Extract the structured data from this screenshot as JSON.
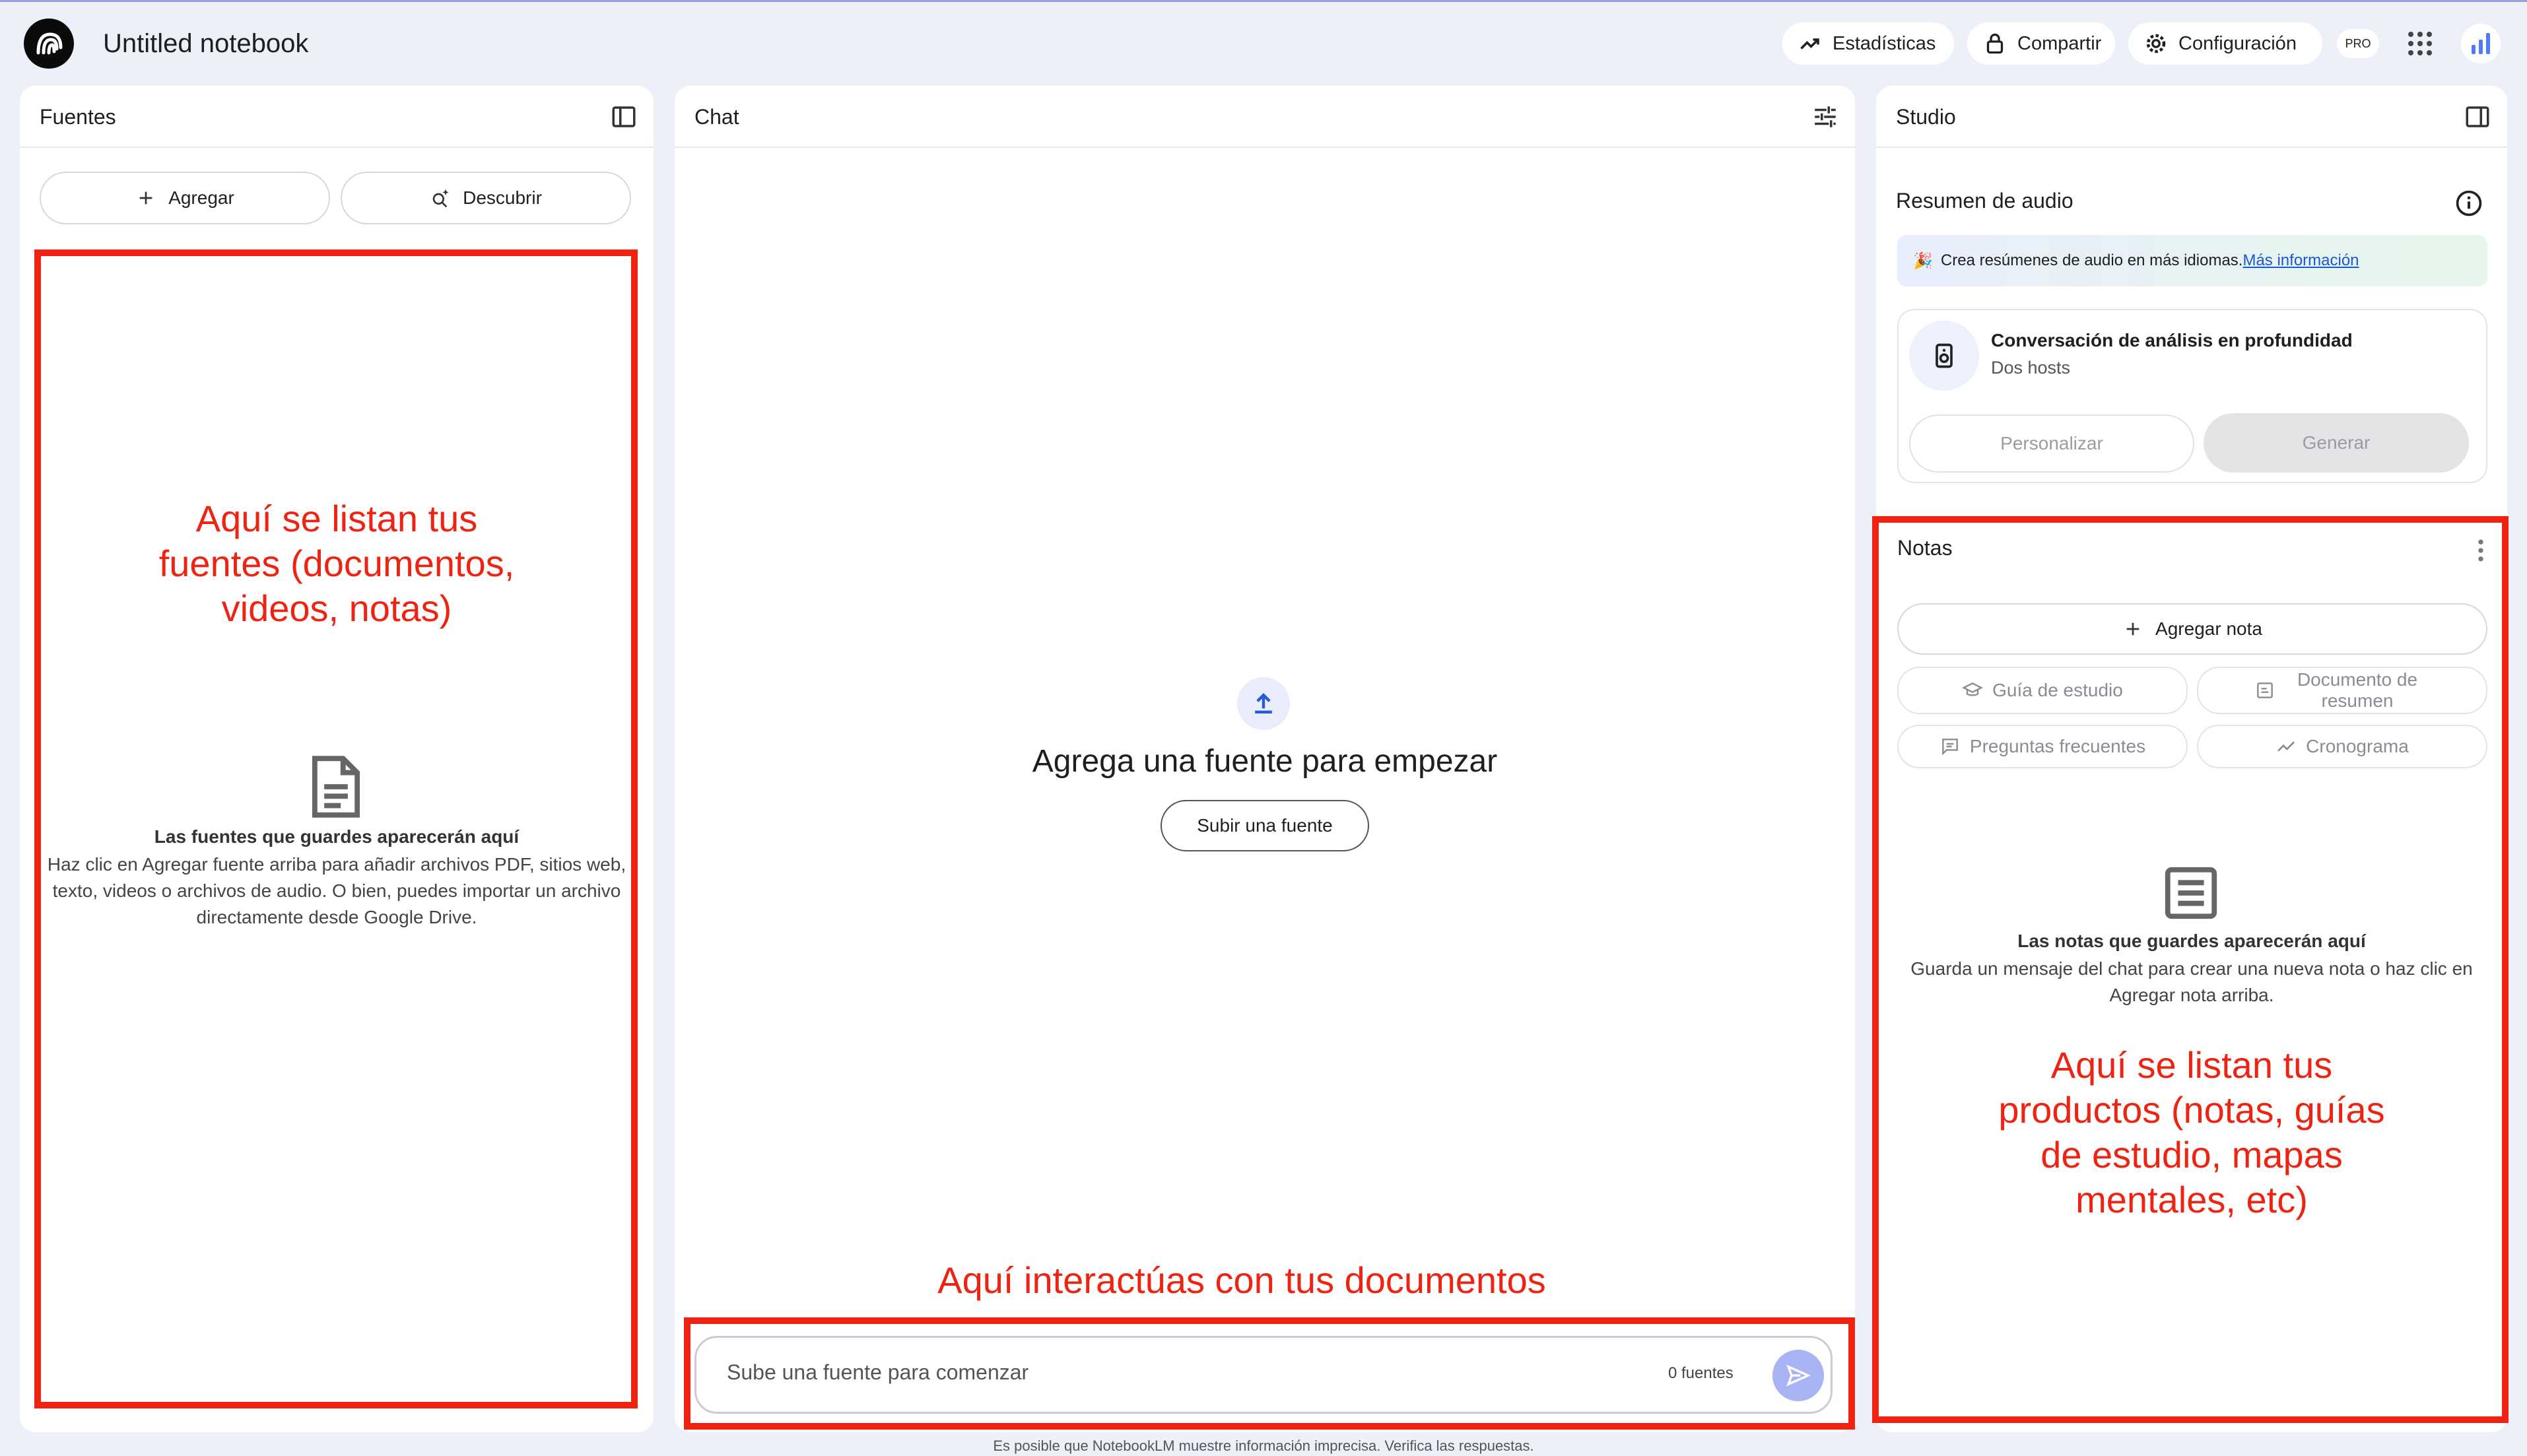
{
  "header": {
    "notebook_title": "Untitled notebook",
    "analytics_label": "Estadísticas",
    "share_label": "Compartir",
    "settings_label": "Configuración",
    "pro_badge": "PRO"
  },
  "sources": {
    "title": "Fuentes",
    "add_label": "Agregar",
    "discover_label": "Descubrir",
    "annotation": "Aquí se listan tus fuentes (documentos, videos, notas)",
    "empty_title": "Las fuentes que guardes aparecerán aquí",
    "empty_desc": "Haz clic en Agregar fuente arriba para añadir archivos PDF, sitios web, texto, videos o archivos de audio. O bien, puedes importar un archivo directamente desde Google Drive."
  },
  "chat": {
    "title": "Chat",
    "empty_heading": "Agrega una fuente para empezar",
    "upload_label": "Subir una fuente",
    "annotation": "Aquí interactúas con tus documentos",
    "input_placeholder": "Sube una fuente para comenzar",
    "source_count": "0 fuentes"
  },
  "studio": {
    "title": "Studio",
    "audio_title": "Resumen de audio",
    "banner_emoji": "🎉",
    "banner_text": "Crea resúmenes de audio en más idiomas.",
    "banner_link": "Más información",
    "deep_dive_title": "Conversación de análisis en profundidad",
    "deep_dive_sub": "Dos hosts",
    "customize_label": "Personalizar",
    "generate_label": "Generar",
    "notes_title": "Notas",
    "add_note_label": "Agregar nota",
    "study_guide_label": "Guía de estudio",
    "summary_doc_label": "Documento de resumen",
    "faq_label": "Preguntas frecuentes",
    "timeline_label": "Cronograma",
    "notes_empty_title": "Las notas que guardes aparecerán aquí",
    "notes_empty_desc": "Guarda un mensaje del chat para crear una nueva nota o haz clic en Agregar nota arriba.",
    "annotation": "Aquí se listan tus productos (notas, guías de estudio, mapas mentales, etc)"
  },
  "footer": {
    "disclaimer": "Es posible que NotebookLM muestre información imprecisa. Verifica las respuestas."
  },
  "colors": {
    "annotation_red": "#ee2312",
    "background": "#eef0f9",
    "send_button": "#a9b4f5",
    "banner_bg": "#e8f0fe",
    "link_blue": "#1a57d6"
  },
  "icons": [
    "notebooklm-logo-icon",
    "trending-up-icon",
    "lock-icon",
    "gear-icon",
    "apps-grid-icon",
    "bar-chart-icon",
    "panel-toggle-icon",
    "plus-icon",
    "search-sparkle-icon",
    "document-icon",
    "upload-icon",
    "tune-icon",
    "send-icon",
    "info-icon",
    "speaker-icon",
    "more-vert-icon",
    "graduation-cap-icon",
    "summary-doc-icon",
    "faq-icon",
    "timeline-icon",
    "notes-icon"
  ]
}
